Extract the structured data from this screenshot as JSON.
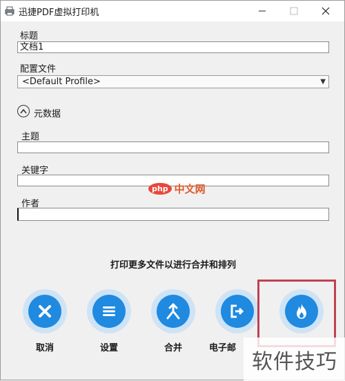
{
  "window": {
    "title": "迅捷PDF虚拟打印机",
    "icon": "printer-icon",
    "controls": [
      "minimize-icon",
      "maximize-icon",
      "close-icon"
    ]
  },
  "form": {
    "title_label": "标题",
    "title_value": "文档1",
    "profile_label": "配置文件",
    "profile_value": "<Default Profile>",
    "metadata_section": "元数据",
    "subject_label": "主题",
    "subject_value": "",
    "keywords_label": "关键字",
    "keywords_value": "",
    "author_label": "作者",
    "author_value": ""
  },
  "hint": "打印更多文件以进行合并和排列",
  "actions": [
    {
      "label": "取消",
      "icon": "cancel-x-icon"
    },
    {
      "label": "设置",
      "icon": "settings-list-icon"
    },
    {
      "label": "合并",
      "icon": "merge-icon"
    },
    {
      "label": "电子邮",
      "icon": "email-export-icon"
    },
    {
      "label": "",
      "icon": "flame-save-icon"
    }
  ],
  "watermarks": {
    "center_badge": "php",
    "center_text": "中文网",
    "corner_text": "软件技巧"
  },
  "colors": {
    "accent": "#1f8ae0",
    "accent_ring": "#cfe3f6",
    "highlight": "#c0404f",
    "background": "#f0f0f0"
  }
}
